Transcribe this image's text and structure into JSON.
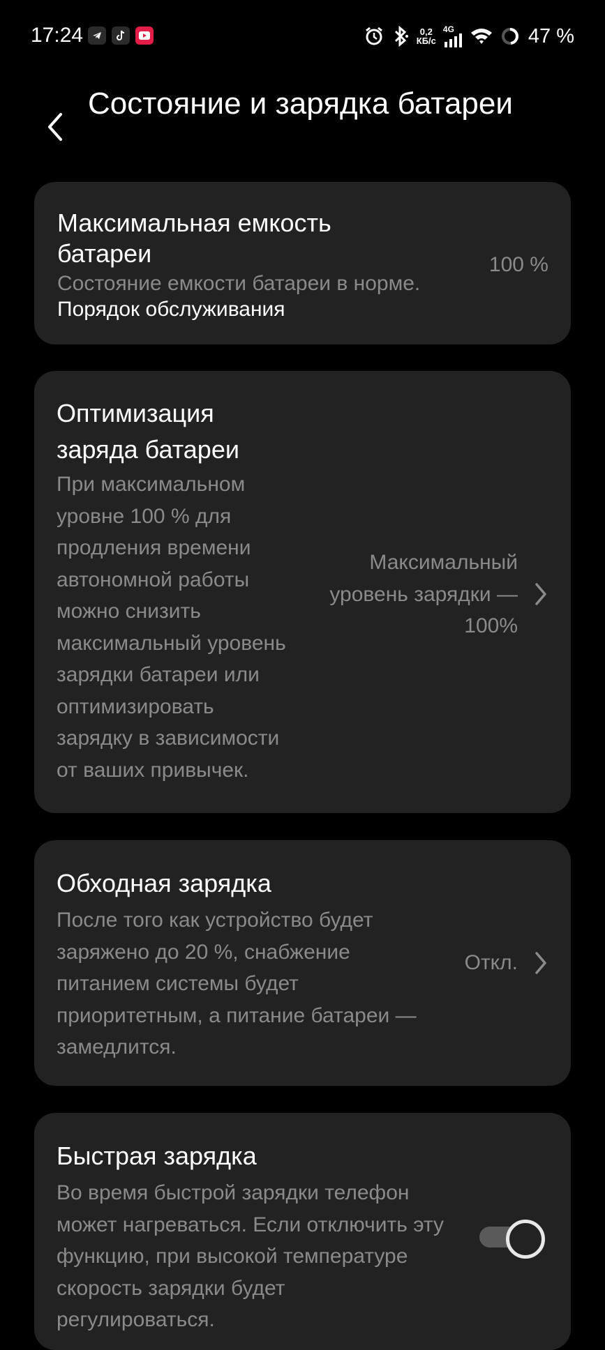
{
  "status_bar": {
    "time": "17:24",
    "net_speed_value": "0,2",
    "net_speed_unit": "КБ/с",
    "network_type": "4G",
    "battery_percent": "47 %"
  },
  "header": {
    "title": "Состояние и зарядка батареи"
  },
  "cards": {
    "capacity": {
      "title_line1": "Максимальная емкость",
      "title_line2": "батареи",
      "description": "Состояние емкости батареи в норме.",
      "link": "Порядок обслуживания",
      "value": "100 %"
    },
    "optimization": {
      "title_line1": "Оптимизация",
      "title_line2": "заряда батареи",
      "description_lines": [
        "При максимальном",
        "уровне 100 % для",
        "продления времени",
        "автономной работы",
        "можно снизить",
        "максимальный уровень",
        "зарядки батареи или",
        "оптимизировать",
        "зарядку в зависимости",
        "от ваших привычек."
      ],
      "value_lines": [
        "Максимальный",
        "уровень зарядки —",
        "100%"
      ]
    },
    "bypass": {
      "title": "Обходная зарядка",
      "description_lines": [
        "После того как устройство будет",
        "заряжено до 20 %, снабжение",
        "питанием системы будет",
        "приоритетным, а питание батареи —",
        "замедлится."
      ],
      "value": "Откл."
    },
    "fast": {
      "title": "Быстрая зарядка",
      "description_lines": [
        "Во время быстрой зарядки телефон",
        "может нагреваться. Если отключить эту",
        "функцию, при высокой температуре",
        "скорость зарядки будет",
        "регулироваться."
      ],
      "toggle_state": "on"
    }
  },
  "colors": {
    "background": "#000000",
    "card": "#222222",
    "primary_text": "#ffffff",
    "secondary_text": "#8a8a8a"
  }
}
